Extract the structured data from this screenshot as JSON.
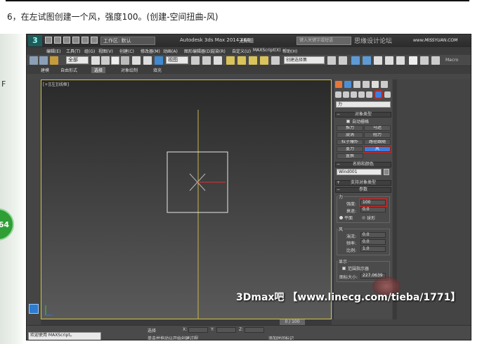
{
  "caption": "6，在左试图创建一个风，强度100。(创建-空间扭曲-风)",
  "side": {
    "letter": "F",
    "badge": "64"
  },
  "titlebar": {
    "workspace": "工作区: 默认",
    "app_title": "Autodesk 3ds Max  2014 x64",
    "file": "无标题",
    "search_placeholder": "键入关键字或短语",
    "watermark": "思缘设计论坛",
    "watermark_url": "www.MISSYUAN.COM"
  },
  "menus": [
    "编辑(E)",
    "工具(T)",
    "组(G)",
    "视图(V)",
    "创建(C)",
    "修改器(M)",
    "动画(A)",
    "图形编辑器(D)",
    "渲染(R)",
    "自定义(U)",
    "MAXScript(X)",
    "帮助(H)"
  ],
  "toolbar": {
    "selection_filter": "全部",
    "ref_coord": "视图",
    "named_selection": "创建选择集",
    "macro_label": "Macro"
  },
  "ribbon": {
    "tabs": [
      "建模",
      "自由形式",
      "选择",
      "对象绘制",
      "填充"
    ],
    "active_index": 2
  },
  "viewport": {
    "label": "[+][左][线框]"
  },
  "command_panel": {
    "category": "力",
    "object_type": {
      "title": "对象类型",
      "autogrid": "自动栅格",
      "buttons": [
        {
          "label": "推力",
          "active": false
        },
        {
          "label": "马达",
          "active": false
        },
        {
          "label": "旋涡",
          "active": false
        },
        {
          "label": "阻力",
          "active": false
        },
        {
          "label": "粒子爆炸",
          "active": false
        },
        {
          "label": "路径跟随",
          "active": false
        },
        {
          "label": "重力",
          "active": false
        },
        {
          "label": "风",
          "active": true
        },
        {
          "label": "置换",
          "active": false
        }
      ]
    },
    "name_color": {
      "title": "名称和颜色",
      "name": "Wind001"
    },
    "supports": {
      "title": "支持对象类型"
    },
    "params": {
      "title": "参数",
      "force_group": "力",
      "strength_label": "强度:",
      "strength": "100",
      "decay_label": "衰退:",
      "decay": "0.0",
      "planar": "平面",
      "spherical": "球形",
      "wind_group": "风",
      "turbulence_label": "湍流:",
      "turbulence": "0.0",
      "frequency_label": "频率:",
      "frequency": "0.0",
      "scale_label": "比例:",
      "scale": "1.0",
      "display_group": "显示",
      "range_indicators": "范围指示器",
      "icon_size_label": "图标大小:",
      "icon_size": "227.0639"
    }
  },
  "timeline": {
    "slider": "0 / 100"
  },
  "status": {
    "welcome": "欢迎使用 MAXScript。",
    "select_label": "选择",
    "prompt": "单击并拖动以开始创建过程",
    "add_time_tag": "添加时间标记",
    "x_label": "X:",
    "y_label": "Y:",
    "z_label": "Z:"
  },
  "bottom_watermark": "3Dmax吧 【www.linecg.com/tieba/1771】",
  "colors": {
    "accent": "#3a7fe0",
    "highlight": "#e02020",
    "viewport_border": "#d4c63a",
    "axis_line": "#c9b64a",
    "gizmo": "#e8e8e8",
    "gizmo_red": "#d33"
  }
}
